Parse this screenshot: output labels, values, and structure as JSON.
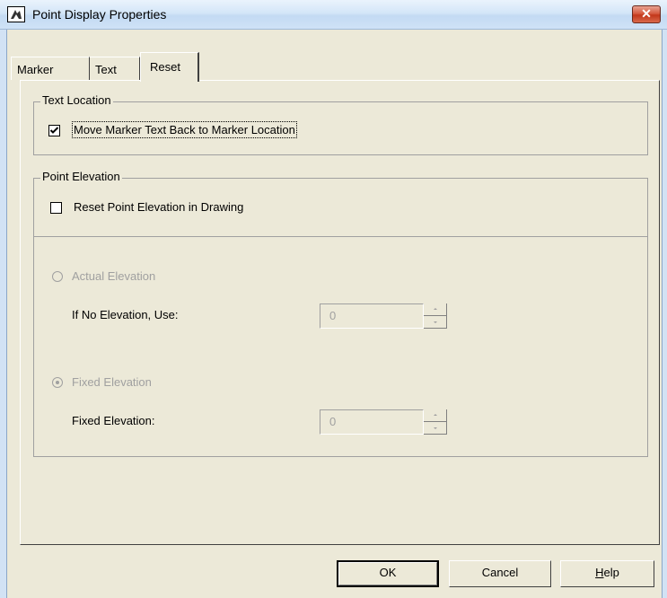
{
  "window": {
    "title": "Point Display Properties",
    "close_glyph": "✕",
    "icon": "surveyor-app-icon"
  },
  "tabs": [
    {
      "label": "Marker",
      "active": false
    },
    {
      "label": "Text",
      "active": false
    },
    {
      "label": "Reset",
      "active": true
    }
  ],
  "text_location": {
    "group_label": "Text Location",
    "checkbox_label": "Move Marker Text Back to Marker Location",
    "checked": true
  },
  "point_elevation": {
    "group_label": "Point Elevation",
    "checkbox_label": "Reset Point Elevation in Drawing",
    "checked": false,
    "actual_elevation": {
      "label": "Actual Elevation",
      "selected": false,
      "field_label": "If No Elevation, Use:",
      "value": "0"
    },
    "fixed_elevation": {
      "label": "Fixed Elevation",
      "selected": true,
      "field_label": "Fixed Elevation:",
      "value": "0"
    }
  },
  "buttons": {
    "ok": "OK",
    "cancel": "Cancel",
    "help_mnemonic": "H",
    "help_rest": "elp"
  },
  "colors": {
    "disabled_text": "#a0a0a0",
    "dialog_bg": "#ece9d8"
  }
}
